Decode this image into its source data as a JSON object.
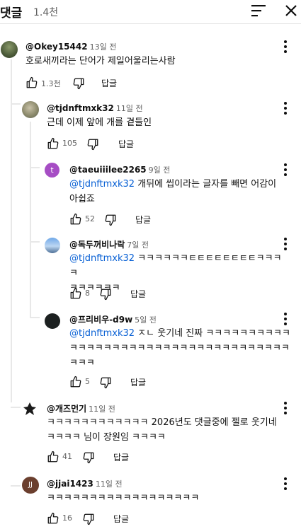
{
  "header": {
    "title": "댓글",
    "count": "1.4천"
  },
  "comments": [
    {
      "author": "@Okey15442",
      "time": "13일 전",
      "text": "호로새끼라는 단어가 제일어울리는사람",
      "likes": "1.3천",
      "reply": "답글"
    },
    {
      "author": "@tjdnftmxk32",
      "time": "11일 전",
      "text": "근데 이제 앞에 개를 곁들인",
      "likes": "105",
      "reply": "답글"
    },
    {
      "author": "@taeuiiilee2265",
      "time": "9일 전",
      "mention": "@tjdnftmxk32",
      "text1": " 개뒤에 씹이라는 글자를 빼면 어감이",
      "text2": "아쉽죠",
      "likes": "52",
      "reply": "답글",
      "avatar_letter": "t"
    },
    {
      "author": "@독두꺼비나락",
      "time": "7일 전",
      "mention": "@tjdnftmxk32",
      "text1": " ㅋㅋㅋㅋㅋㅋㅌㅌㅌㅌㅌㅌㅌㅌㅋㅋㅋㅋ",
      "text2": "ㅋㅋㅋㅋㅋㅋ",
      "likes": "8",
      "reply": "답글"
    },
    {
      "author": "@프리비우-d9w",
      "time": "5일 전",
      "mention": "@tjdnftmxk32",
      "text1": " ㅈㄴ 웃기네 진짜 ㅋㅋㅋㅋㅋㅋㅋㅋㅋㅋ",
      "text2": "ㅋㅋㅋㅋㅋㅋㅋㅋㅋㅋㅋㅋㅋㅋㅋㅋㅋㅋㅋㅋㅋㅋㅋㅋㅋㅋ",
      "text3": "ㅋㅋㅋ",
      "likes": "5",
      "reply": "답글"
    },
    {
      "author": "@개즈먼기",
      "time": "11일 전",
      "text1": "ㅋㅋㅋㅋㅋㅋㅋㅋㅋㅋㅋㅋ 2026년도 댓글중에 젤로 웃기네",
      "text2": "ㅋㅋㅋㅋ 님이 장원임 ㅋㅋㅋㅋ",
      "likes": "41",
      "reply": "답글"
    },
    {
      "author": "@jjai1423",
      "time": "11일 전",
      "text": "ㅋㅋㅋㅋㅋㅋㅋㅋㅋㅋㅋㅋㅋㅋㅋㅋㅋㅋ",
      "likes": "16",
      "reply": "답글",
      "avatar_letter": "JJ"
    }
  ],
  "colors": {
    "mention": "#065fd4",
    "secondary_text": "#606060",
    "thread_line": "#e8e8e8"
  },
  "icons": [
    "sort-icon",
    "close-icon",
    "more-vert-icon",
    "thumb-up-icon",
    "thumb-down-icon"
  ]
}
